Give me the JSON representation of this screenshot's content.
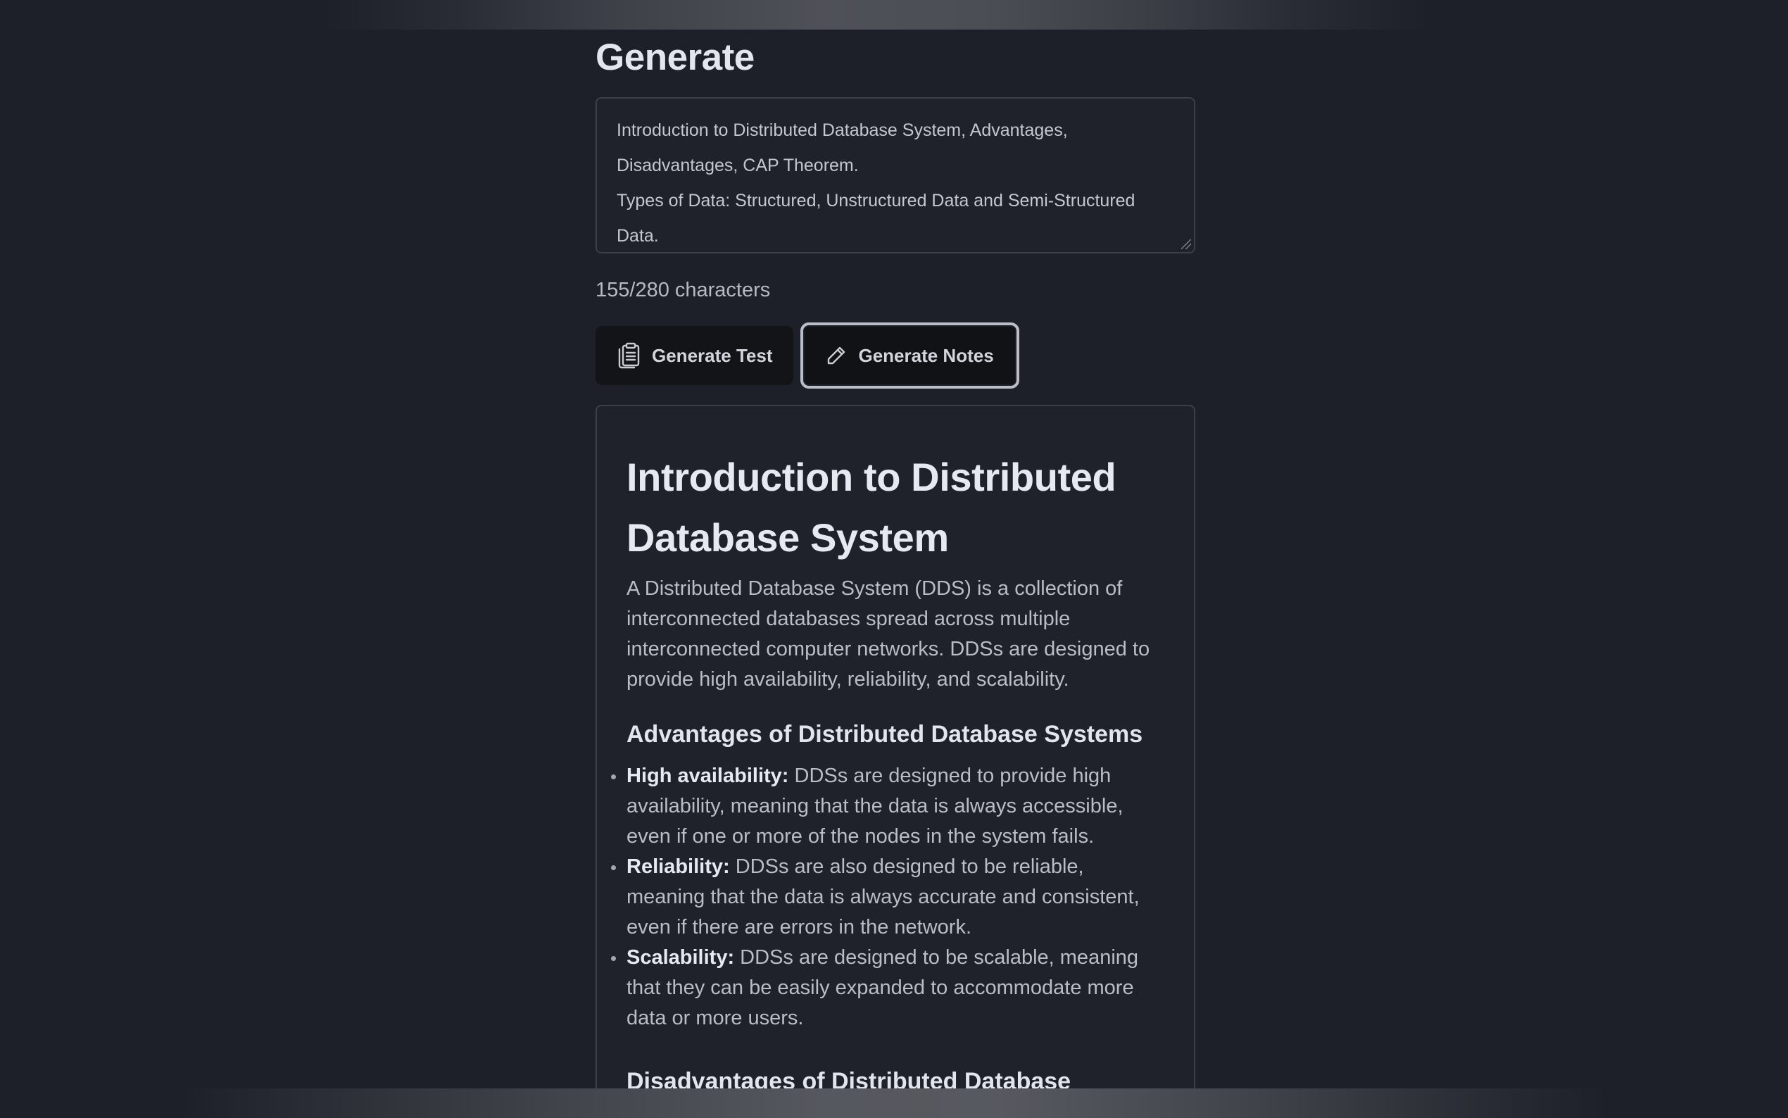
{
  "page": {
    "title": "Generate"
  },
  "prompt": {
    "value": "Introduction to Distributed Database System, Advantages,\nDisadvantages, CAP Theorem.\nTypes of Data: Structured, Unstructured Data and Semi-Structured\nData.",
    "char_count": "155/280 characters"
  },
  "actions": {
    "generate_test": {
      "label": "Generate Test",
      "icon": "clipboard-icon"
    },
    "generate_notes": {
      "label": "Generate Notes",
      "icon": "pencil-icon"
    }
  },
  "notes": {
    "heading": "Introduction to Distributed Database System",
    "intro": "A Distributed Database System (DDS) is a collection of interconnected databases spread across multiple interconnected computer networks. DDSs are designed to provide high availability, reliability, and scalability.",
    "advantages_heading": "Advantages of Distributed Database Systems",
    "advantages": [
      {
        "term": "High availability:",
        "text": " DDSs are designed to provide high availability, meaning that the data is always accessible, even if one or more of the nodes in the system fails."
      },
      {
        "term": "Reliability:",
        "text": " DDSs are also designed to be reliable, meaning that the data is always accurate and consistent, even if there are errors in the network."
      },
      {
        "term": "Scalability:",
        "text": " DDSs are designed to be scalable, meaning that they can be easily expanded to accommodate more data or more users."
      }
    ],
    "disadvantages_heading": "Disadvantages of Distributed Database"
  },
  "colors": {
    "background": "#1d2028",
    "panel": "#1f222a",
    "border": "#3b3f49",
    "button": "#121418",
    "focus_ring": "#b9bec7",
    "heading_text": "#e6e9ef",
    "body_text": "#b9bdc6"
  }
}
